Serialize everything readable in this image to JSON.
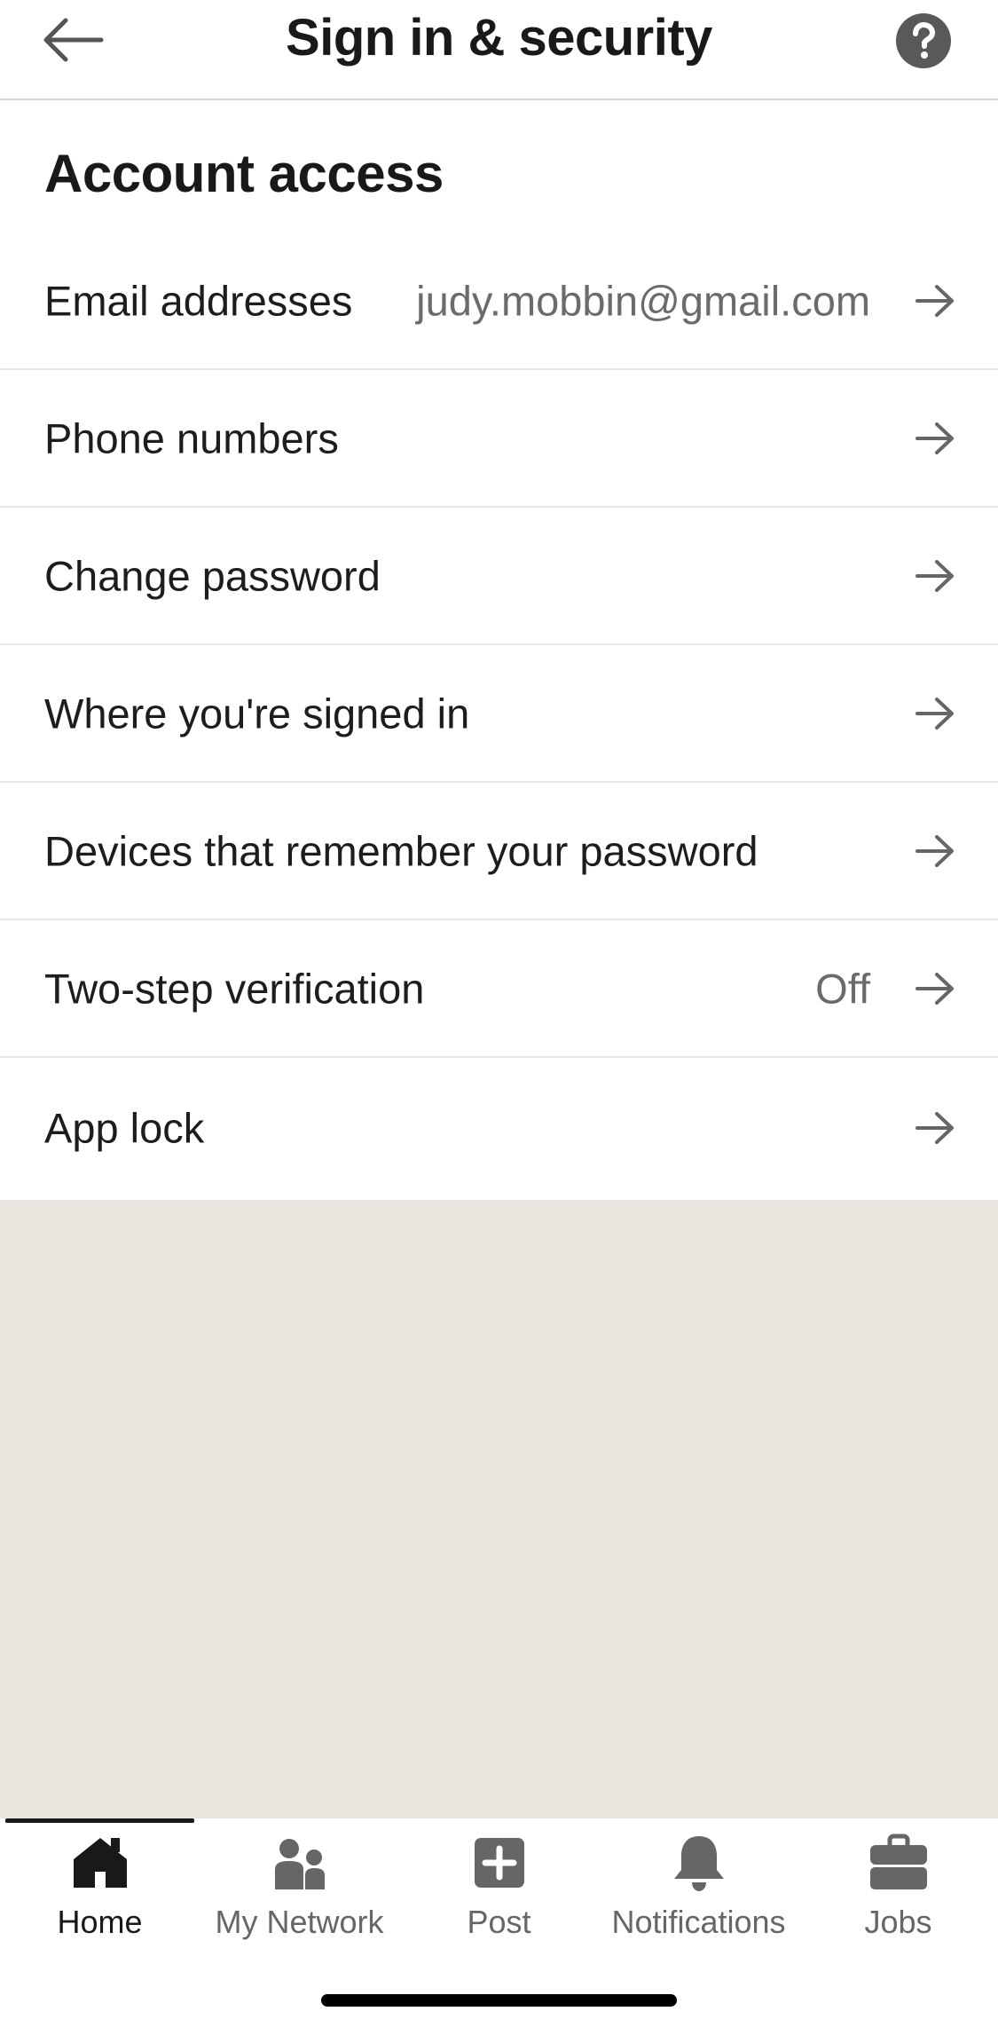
{
  "header": {
    "title": "Sign in & security",
    "back_icon": "arrow-left-icon",
    "help_icon": "question-circle-icon"
  },
  "section": {
    "title": "Account access"
  },
  "rows": [
    {
      "label": "Email addresses",
      "value": "judy.mobbin@gmail.com"
    },
    {
      "label": "Phone numbers",
      "value": ""
    },
    {
      "label": "Change password",
      "value": ""
    },
    {
      "label": "Where you're signed in",
      "value": ""
    },
    {
      "label": "Devices that remember your password",
      "value": ""
    },
    {
      "label": "Two-step verification",
      "value": "Off"
    },
    {
      "label": "App lock",
      "value": ""
    }
  ],
  "tabs": [
    {
      "label": "Home",
      "icon": "home-icon",
      "active": true
    },
    {
      "label": "My Network",
      "icon": "people-icon",
      "active": false
    },
    {
      "label": "Post",
      "icon": "plus-square-icon",
      "active": false
    },
    {
      "label": "Notifications",
      "icon": "bell-icon",
      "active": false
    },
    {
      "label": "Jobs",
      "icon": "briefcase-icon",
      "active": false
    }
  ],
  "colors": {
    "text": "#191919",
    "secondary_text": "#666666",
    "empty_area": "#e8e5df",
    "divider": "#e6e6e6"
  }
}
